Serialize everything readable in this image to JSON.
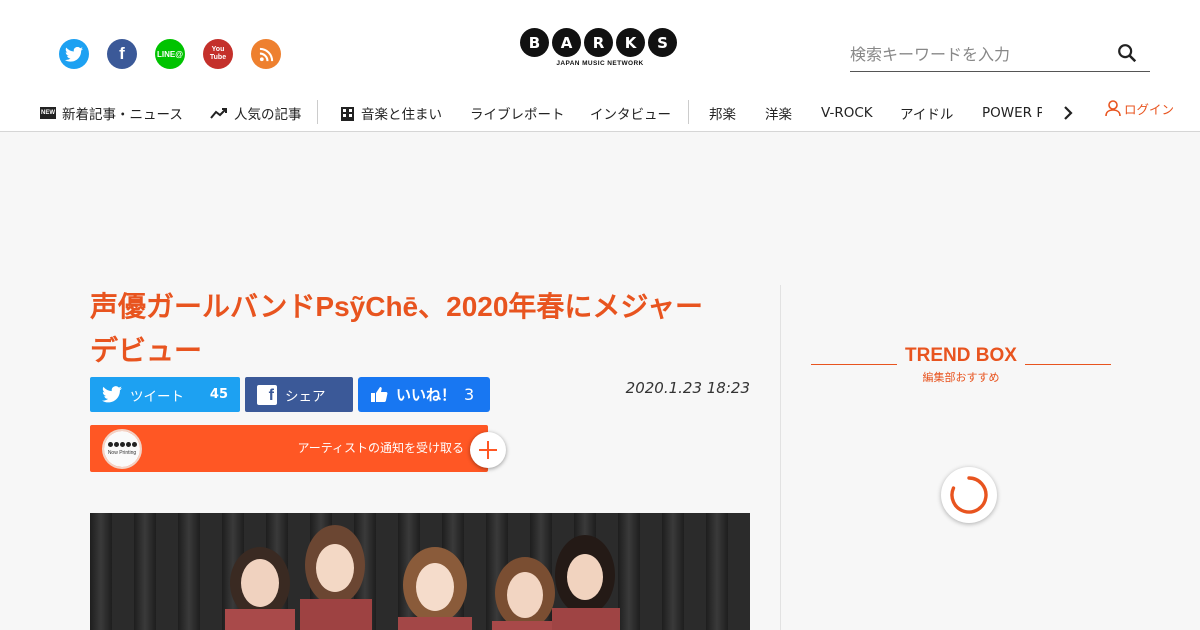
{
  "brand": {
    "logo_letters": [
      "B",
      "A",
      "R",
      "K",
      "S"
    ],
    "logo_sub": "JAPAN MUSIC NETWORK",
    "accent": "#e8541f"
  },
  "social_icons": [
    "twitter-icon",
    "facebook-icon",
    "line-icon",
    "youtube-icon",
    "rss-icon"
  ],
  "search": {
    "placeholder": "検索キーワードを入力"
  },
  "nav": {
    "latest": "新着記事・ニュース",
    "popular": "人気の記事",
    "music_home": "音楽と住まい",
    "live_report": "ライブレポート",
    "interview": "インタビュー",
    "hogaku": "邦楽",
    "yogaku": "洋楽",
    "vrock": "V-ROCK",
    "idol": "アイドル",
    "power": "POWER P",
    "login": "ログイン"
  },
  "article": {
    "title_line1": "声優ガールバンドPsỹChē、2020年春にメジャー",
    "title_line2": "デビュー",
    "date": "2020.1.23 18:23",
    "tweet_label": "ツイート",
    "tweet_count": "45",
    "share_label": "シェア",
    "like_label": "いいね！",
    "like_count": "3",
    "notify_label": "アーティストの通知を受け取る",
    "avatar_text": "Now Printing"
  },
  "sidebar": {
    "trend_title": "TREND BOX",
    "trend_sub": "編集部おすすめ"
  }
}
